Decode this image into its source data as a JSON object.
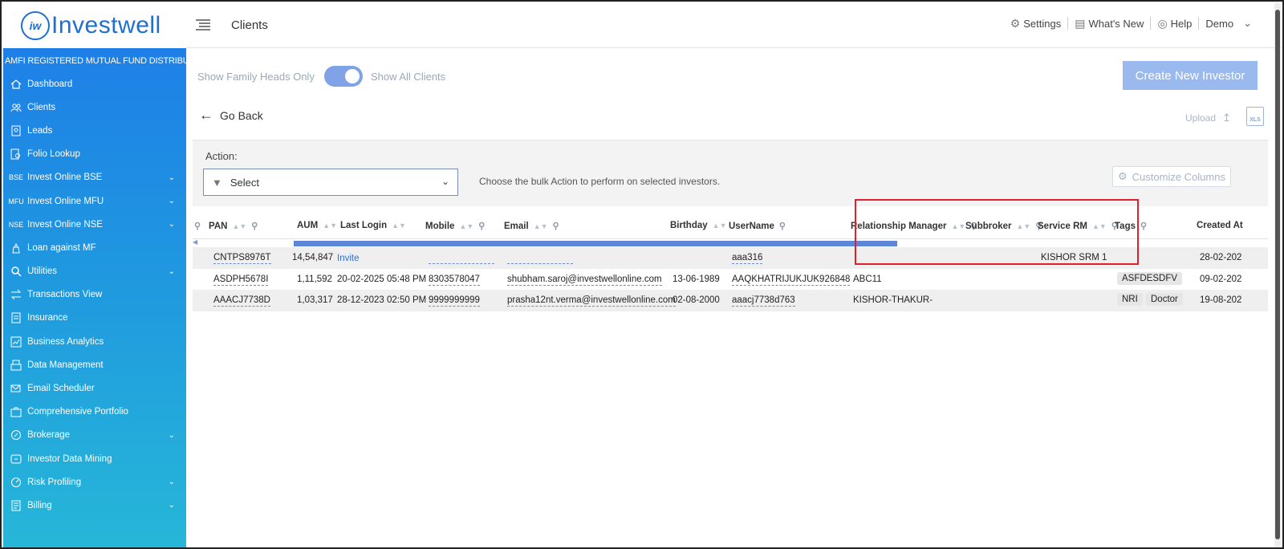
{
  "brand": {
    "logo_mark": "iw",
    "name": "Investwell",
    "tagline": "AMFI REGISTERED MUTUAL FUND DISTRIBUTOR"
  },
  "sidebar": {
    "items": [
      {
        "label": "Dashboard",
        "icon": "home-icon",
        "expandable": false
      },
      {
        "label": "Clients",
        "icon": "users-icon",
        "expandable": false
      },
      {
        "label": "Leads",
        "icon": "leads-icon",
        "expandable": false
      },
      {
        "label": "Folio Lookup",
        "icon": "folio-icon",
        "expandable": false
      },
      {
        "label": "Invest Online BSE",
        "icon": "bse-icon",
        "icon_text": "BSE",
        "expandable": true
      },
      {
        "label": "Invest Online MFU",
        "icon": "mfu-icon",
        "icon_text": "MFU",
        "expandable": true
      },
      {
        "label": "Invest Online NSE",
        "icon": "nse-icon",
        "icon_text": "NSE",
        "expandable": true
      },
      {
        "label": "Loan against MF",
        "icon": "loan-icon",
        "expandable": false
      },
      {
        "label": "Utilities",
        "icon": "utilities-icon",
        "expandable": true
      },
      {
        "label": "Transactions View",
        "icon": "transactions-icon",
        "expandable": false
      },
      {
        "label": "Insurance",
        "icon": "insurance-icon",
        "expandable": false
      },
      {
        "label": "Business Analytics",
        "icon": "analytics-icon",
        "expandable": false
      },
      {
        "label": "Data Management",
        "icon": "data-icon",
        "expandable": false
      },
      {
        "label": "Email Scheduler",
        "icon": "email-icon",
        "expandable": false
      },
      {
        "label": "Comprehensive Portfolio",
        "icon": "portfolio-icon",
        "expandable": false
      },
      {
        "label": "Brokerage",
        "icon": "brokerage-icon",
        "expandable": true
      },
      {
        "label": "Investor Data Mining",
        "icon": "mining-icon",
        "expandable": false
      },
      {
        "label": "Risk Profiling",
        "icon": "risk-icon",
        "expandable": true
      },
      {
        "label": "Billing",
        "icon": "billing-icon",
        "expandable": true
      }
    ]
  },
  "header": {
    "title": "Clients",
    "settings": "Settings",
    "whats_new": "What's New",
    "help": "Help",
    "user": "Demo"
  },
  "main": {
    "toggle_left": "Show Family Heads Only",
    "toggle_right": "Show All Clients",
    "create_button": "Create New Investor",
    "go_back": "Go Back",
    "upload": "Upload",
    "xls_label": "XLS",
    "action_label": "Action:",
    "select_value": "Select",
    "hint": "Choose the bulk Action to perform on selected investors.",
    "customize": "Customize Columns"
  },
  "table": {
    "columns": {
      "pan": "PAN",
      "aum": "AUM",
      "last_login": "Last Login",
      "mobile": "Mobile",
      "email": "Email",
      "birthday": "Birthday",
      "username": "UserName",
      "rm": "Relationship Manager",
      "subbroker": "Subbroker",
      "service_rm": "Service RM",
      "tags": "Tags",
      "created_at": "Created At"
    },
    "rows": [
      {
        "pan": "CNTPS8976T",
        "aum": "14,54,847",
        "last_login": "Invite",
        "mobile": "",
        "email": "",
        "birthday": "",
        "username": "aaa316",
        "rm": "",
        "subbroker": "",
        "service_rm": "KISHOR SRM 1",
        "tags": [],
        "created_at": "28-02-202"
      },
      {
        "pan": "ASDPH5678I",
        "aum": "1,11,592",
        "last_login": "20-02-2025 05:48 PM",
        "mobile": "8303578047",
        "email": "shubham.saroj@investwellonline.com",
        "birthday": "13-06-1989",
        "username": "AAQKHATRIJUKJUK926848",
        "rm": "ABC11",
        "subbroker": "",
        "service_rm": "",
        "tags": [
          "ASFDESDFV"
        ],
        "created_at": "09-02-202"
      },
      {
        "pan": "AAACJ7738D",
        "aum": "1,03,317",
        "last_login": "28-12-2023 02:50 PM",
        "mobile": "9999999999",
        "email": "prasha12nt.verma@investwellonline.com",
        "birthday": "02-08-2000",
        "username": "aaacj7738d763",
        "rm": "KISHOR-THAKUR-",
        "subbroker": "",
        "service_rm": "",
        "tags": [
          "NRI",
          "Doctor"
        ],
        "created_at": "19-08-202"
      }
    ]
  },
  "colors": {
    "accent": "#1f6fd1",
    "highlight": "#e0202a",
    "button": "#9ab9ef"
  }
}
